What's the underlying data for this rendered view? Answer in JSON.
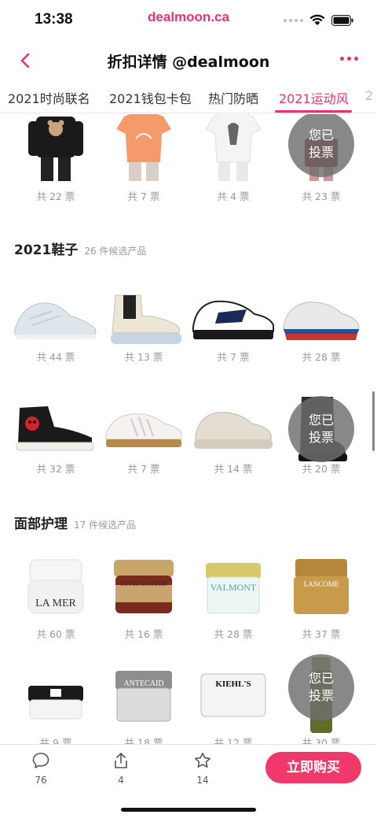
{
  "status": {
    "time": "13:38",
    "url": "dealmoon.ca"
  },
  "header": {
    "title": "折扣详情 @dealmoon"
  },
  "tabs": [
    {
      "label": "2021时尚联名"
    },
    {
      "label": "2021钱包卡包"
    },
    {
      "label": "热门防晒"
    },
    {
      "label": "2021运动风"
    },
    {
      "label": "2"
    }
  ],
  "voted_label": {
    "line1": "您已",
    "line2": "投票"
  },
  "top_row": [
    {
      "count": "共 22 票"
    },
    {
      "count": "共 7 票"
    },
    {
      "count": "共 4 票"
    },
    {
      "count": "共 23 票"
    }
  ],
  "shoes": {
    "title": "2021鞋子",
    "subtitle": "26 件候选产品",
    "items": [
      {
        "count": "共 44 票"
      },
      {
        "count": "共 13 票"
      },
      {
        "count": "共 7 票"
      },
      {
        "count": "共 28 票"
      },
      {
        "count": "共 32 票"
      },
      {
        "count": "共 7 票"
      },
      {
        "count": "共 14 票"
      },
      {
        "count": "共 20 票"
      }
    ]
  },
  "face": {
    "title": "面部护理",
    "subtitle": "17 件候选产品",
    "items": [
      {
        "count": "共 60 票",
        "brand": "LA MER"
      },
      {
        "count": "共 16 票",
        "brand": "ESTEE LAUDER"
      },
      {
        "count": "共 28 票",
        "brand": "VALMONT"
      },
      {
        "count": "共 37 票",
        "brand": "LANCOME"
      },
      {
        "count": "共 9 票"
      },
      {
        "count": "共 18 票",
        "brand": "ANTECAID"
      },
      {
        "count": "共 12 票",
        "brand": "KIEHL'S"
      },
      {
        "count": "共 30 票"
      }
    ]
  },
  "bottom": {
    "comments": "76",
    "shares": "4",
    "favorites": "14",
    "buy_label": "立即购买"
  },
  "colors": {
    "accent": "#e8336b",
    "buy": "#f0386b"
  }
}
